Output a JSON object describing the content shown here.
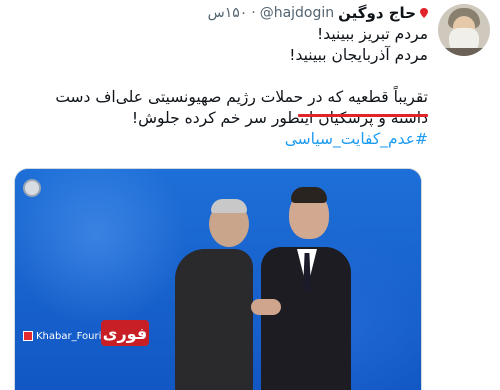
{
  "tweet": {
    "author_name": "حاج دوگین",
    "handle": "@hajdogin",
    "separator": "·",
    "time": "۱۵۰س",
    "lines": [
      "مردم تبریز ببینید!",
      "مردم آذربایجان ببینید!",
      "تقریباً قطعیه که در حملات رژیم صهیونسیتی علی‌اف دست",
      "داشته و پرسکیان اینطور سر خم کرده جلوش!"
    ],
    "hashtag": "#عدم_کفایت_سیاسی"
  },
  "media": {
    "badge": "فوری",
    "logo_text": "Khabar_Fouri"
  },
  "colors": {
    "hashtag": "#1d9bf0",
    "underline": "#e0242a",
    "badge": "#c81f26"
  }
}
